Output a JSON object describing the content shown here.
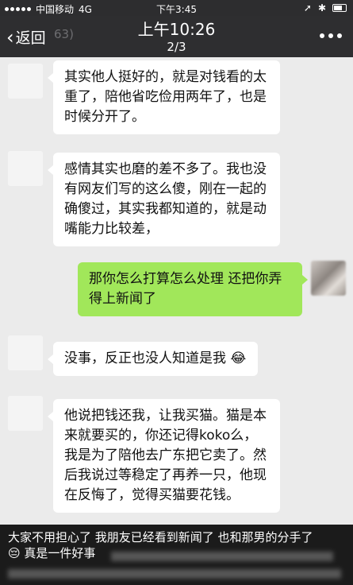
{
  "status_bar": {
    "carrier": "中国移动",
    "network": "4G",
    "time": "下午3:45"
  },
  "nav": {
    "back_label": "返回",
    "behind_text": "63)",
    "title": "上午10:26",
    "subtitle": "2/3",
    "more_icon": "more-dots-icon"
  },
  "messages": [
    {
      "side": "them",
      "text": "其实他人挺好的，就是对钱看的太重了，陪他省吃俭用两年了，也是时候分开了。"
    },
    {
      "side": "them",
      "text": "感情其实也磨的差不多了。我也没有网友们写的这么傻，刚在一起的确傻过，其实我都知道的，就是动嘴能力比较差，"
    },
    {
      "side": "me",
      "text": "那你怎么打算怎么处理  还把你弄得上新闻了"
    },
    {
      "side": "them",
      "text": "没事，反正也没人知道是我",
      "emoji": "😂"
    },
    {
      "side": "them",
      "text": "他说把钱还我，让我买猫。猫是本来就要买的，你还记得koko么，我是为了陪他去广东把它卖了。然后我说过等稳定了再养一只，他现在反悔了，觉得买猫要花钱。"
    }
  ],
  "caption": {
    "line1": "大家不用担心了 我朋友已经看到新闻了  也和那男的分手了",
    "emoji": "😔",
    "line2": "真是一件好事"
  },
  "colors": {
    "my_bubble": "#a1e75a",
    "their_bubble": "#ffffff",
    "chat_bg": "#ebebeb",
    "nav_bg": "#2e2e30"
  }
}
